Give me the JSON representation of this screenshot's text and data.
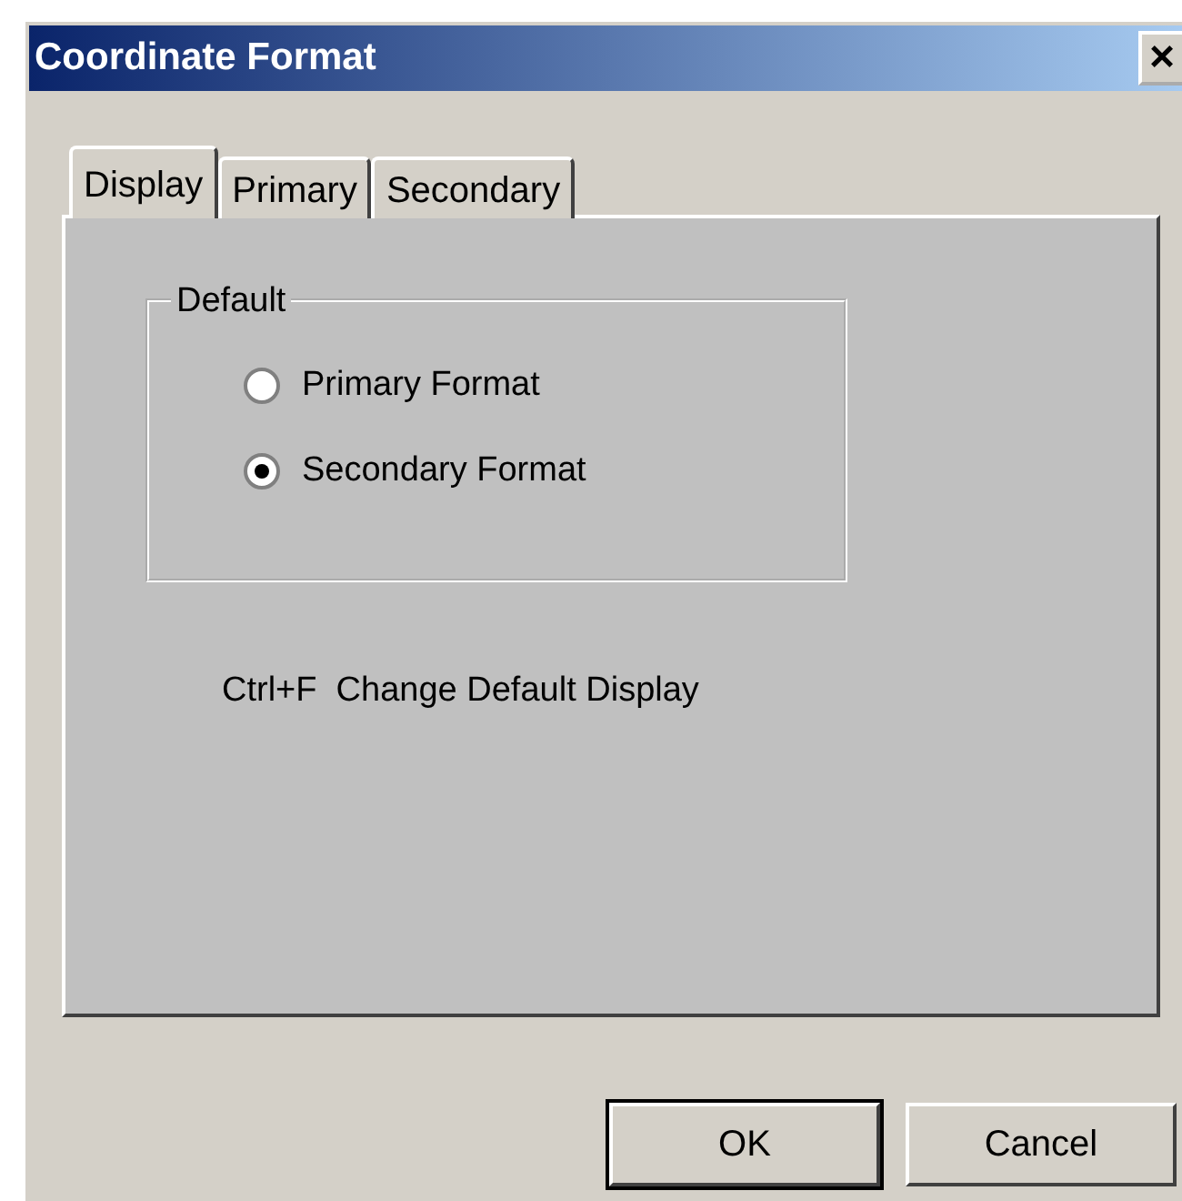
{
  "window": {
    "title": "Coordinate Format",
    "close": "×"
  },
  "tabs": [
    {
      "label": "Display",
      "selected": true
    },
    {
      "label": "Primary",
      "selected": false
    },
    {
      "label": "Secondary",
      "selected": false
    }
  ],
  "group": {
    "title": "Default",
    "options": [
      {
        "label": "Primary Format",
        "selected": false
      },
      {
        "label": "Secondary Format",
        "selected": true
      }
    ]
  },
  "hint": "Ctrl+F  Change Default Display",
  "buttons": [
    {
      "label": "OK",
      "default": true
    },
    {
      "label": "Cancel",
      "default": false
    }
  ]
}
